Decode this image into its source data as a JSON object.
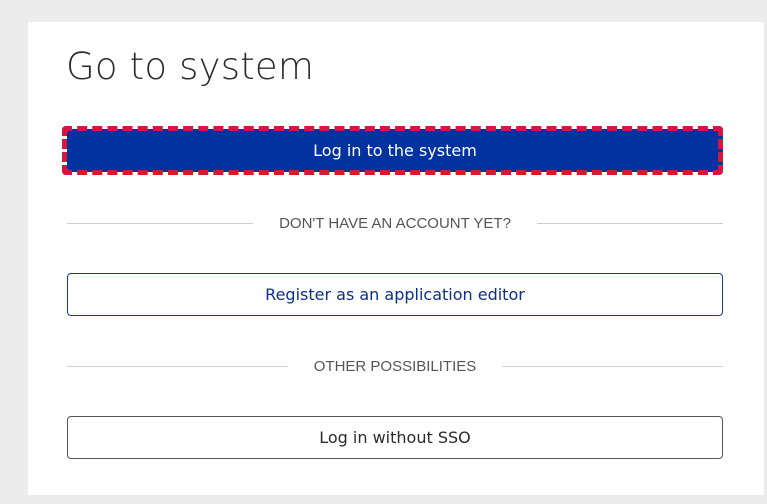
{
  "login_card": {
    "title": "Go to system",
    "primary_button_label": "Log in to the system",
    "no_account_divider": "DON'T HAVE AN ACCOUNT YET?",
    "register_button_label": "Register as an application editor",
    "other_divider": "OTHER POSSIBILITIES",
    "no_sso_button_label": "Log in without SSO"
  },
  "colors": {
    "primary": "#0033a0",
    "highlight": "#d5173f",
    "background": "#ececec",
    "card": "#ffffff"
  }
}
